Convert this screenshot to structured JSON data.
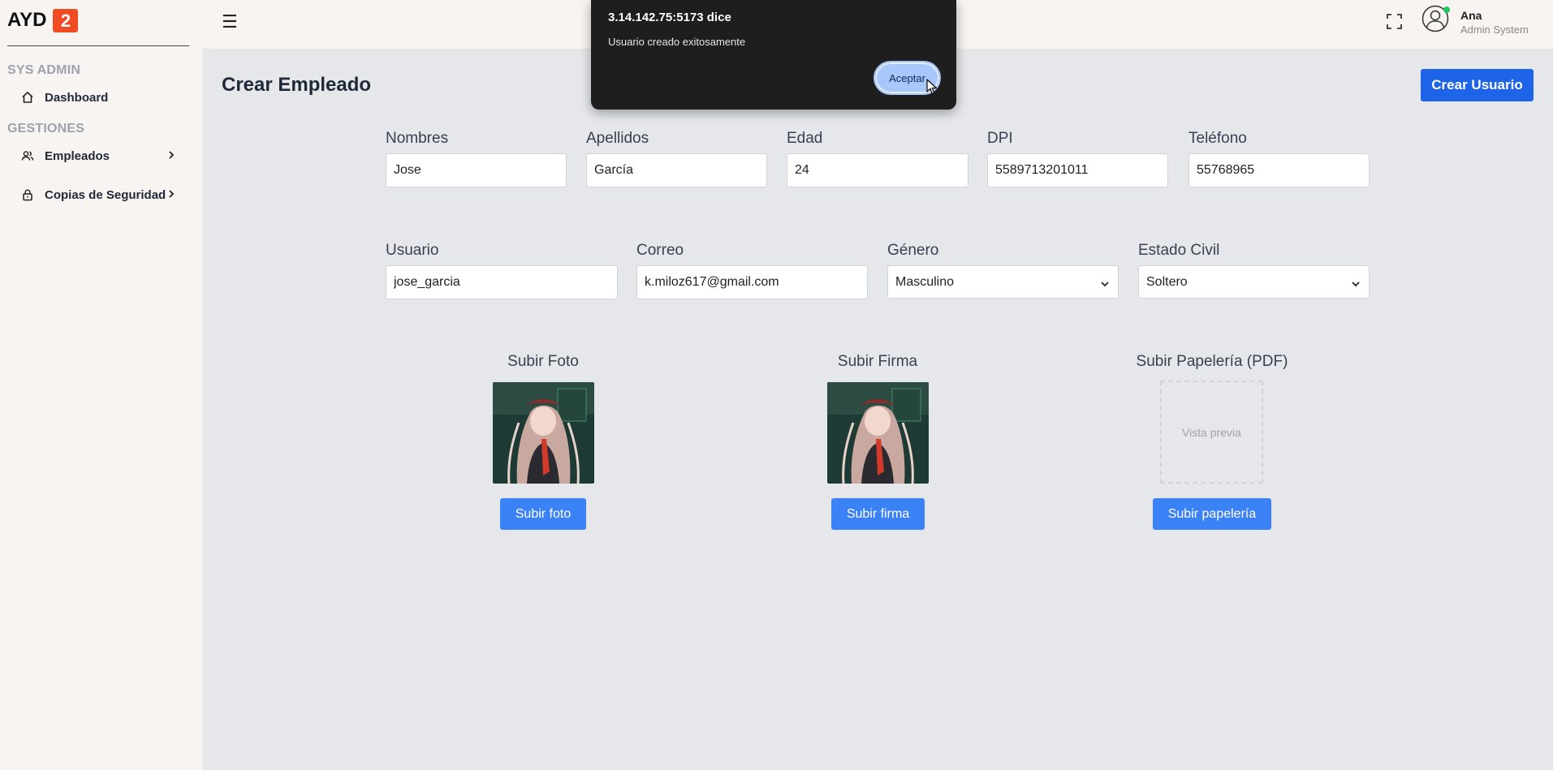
{
  "brand": {
    "name": "AYD",
    "badge": "2"
  },
  "sidebar": {
    "section_sys": "SYS ADMIN",
    "section_gestiones": "GESTIONES",
    "items": [
      {
        "label": "Dashboard",
        "icon": "home-icon"
      },
      {
        "label": "Empleados",
        "icon": "users-icon"
      },
      {
        "label": "Copias de Seguridad",
        "icon": "lock-icon"
      }
    ]
  },
  "topbar": {
    "user_name": "Ana",
    "user_role": "Admin System"
  },
  "page": {
    "title": "Crear Empleado",
    "create_button": "Crear Usuario"
  },
  "form": {
    "nombres": {
      "label": "Nombres",
      "value": "Jose"
    },
    "apellidos": {
      "label": "Apellidos",
      "value": "García"
    },
    "edad": {
      "label": "Edad",
      "value": "24"
    },
    "dpi": {
      "label": "DPI",
      "value": "5589713201011"
    },
    "telefono": {
      "label": "Teléfono",
      "value": "55768965"
    },
    "usuario": {
      "label": "Usuario",
      "value": "jose_garcia"
    },
    "correo": {
      "label": "Correo",
      "value": "k.miloz617@gmail.com"
    },
    "genero": {
      "label": "Género",
      "value": "Masculino"
    },
    "estado_civil": {
      "label": "Estado Civil",
      "value": "Soltero"
    }
  },
  "uploads": {
    "foto": {
      "title": "Subir Foto",
      "button": "Subir foto"
    },
    "firma": {
      "title": "Subir Firma",
      "button": "Subir firma"
    },
    "papeleria": {
      "title": "Subir Papelería (PDF)",
      "preview": "Vista previa",
      "button": "Subir papelería"
    }
  },
  "dialog": {
    "title": "3.14.142.75:5173 dice",
    "message": "Usuario creado exitosamente",
    "button": "Aceptar"
  },
  "colors": {
    "primary": "#1d64e8",
    "upload_button": "#3b82f6",
    "brand_badge": "#ef4c23",
    "online_dot": "#22c55e"
  }
}
